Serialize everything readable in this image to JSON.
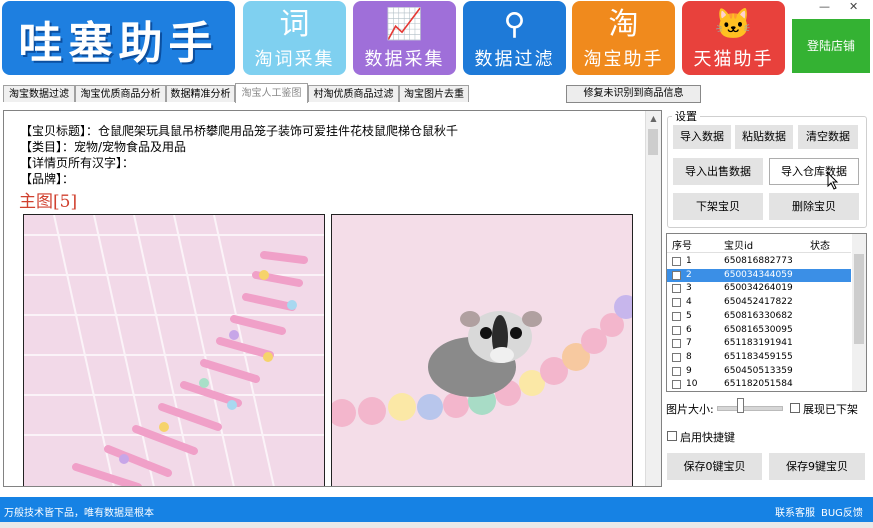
{
  "window": {
    "minimize": "—",
    "close": "✕"
  },
  "logo": {
    "text": "哇塞助手"
  },
  "tiles": [
    {
      "icon": "词",
      "label": "淘词采集",
      "color": "#7fd0f0",
      "name": "tile-taoci"
    },
    {
      "icon": "📈",
      "label": "数据采集",
      "color": "#9f6fd9",
      "name": "tile-data-collect"
    },
    {
      "icon": "⚲",
      "label": "数据过滤",
      "color": "#1e7ad8",
      "name": "tile-data-filter"
    },
    {
      "icon": "淘",
      "label": "淘宝助手",
      "color": "#f08a1d",
      "name": "tile-taobao"
    },
    {
      "icon": "🐱",
      "label": "天猫助手",
      "color": "#e8413c",
      "name": "tile-tmall"
    }
  ],
  "login_button": "登陆店铺",
  "tabs": [
    "淘宝数据过滤",
    "淘宝优质商品分析",
    "数据精准分析",
    "淘宝人工鉴图",
    "村淘优质商品过滤",
    "淘宝图片去重"
  ],
  "active_tab": 3,
  "repair_button": "修复未识别到商品信息",
  "product": {
    "title_line": "【宝贝标题】：仓鼠爬架玩具鼠吊桥攀爬用品笼子装饰可爱挂件花枝鼠爬梯仓鼠秋千",
    "category_line": "【类目】：宠物/宠物食品及用品",
    "detail_line": "【详情页所有汉字】：",
    "brand_line": "【品牌】：",
    "main_image_label": "主图[5]"
  },
  "settings": {
    "title": "设置",
    "import_data": "导入数据",
    "paste_data": "粘贴数据",
    "clear_data": "清空数据",
    "import_sale": "导入出售数据",
    "import_warehouse": "导入仓库数据",
    "delist": "下架宝贝",
    "delete": "删除宝贝"
  },
  "list": {
    "columns": [
      "序号",
      "宝贝id",
      "状态"
    ],
    "rows": [
      {
        "no": "1",
        "id": "650816882773"
      },
      {
        "no": "2",
        "id": "650034344059"
      },
      {
        "no": "3",
        "id": "650034264019"
      },
      {
        "no": "4",
        "id": "650452417822"
      },
      {
        "no": "5",
        "id": "650816330682"
      },
      {
        "no": "6",
        "id": "650816530095"
      },
      {
        "no": "7",
        "id": "651183191941"
      },
      {
        "no": "8",
        "id": "651183459155"
      },
      {
        "no": "9",
        "id": "650450513359"
      },
      {
        "no": "10",
        "id": "651182051584"
      }
    ],
    "selected_index": 1
  },
  "image_size_label": "图片大小:",
  "image_size_level": 0.33,
  "show_delisted": "展现已下架",
  "enable_shortcut": "启用快捷键",
  "save_0": "保存0键宝贝",
  "save_9": "保存9键宝贝",
  "status": {
    "left": "万般技术皆下品，唯有数据是根本",
    "contact": "联系客服",
    "bug": "BUG反馈"
  }
}
